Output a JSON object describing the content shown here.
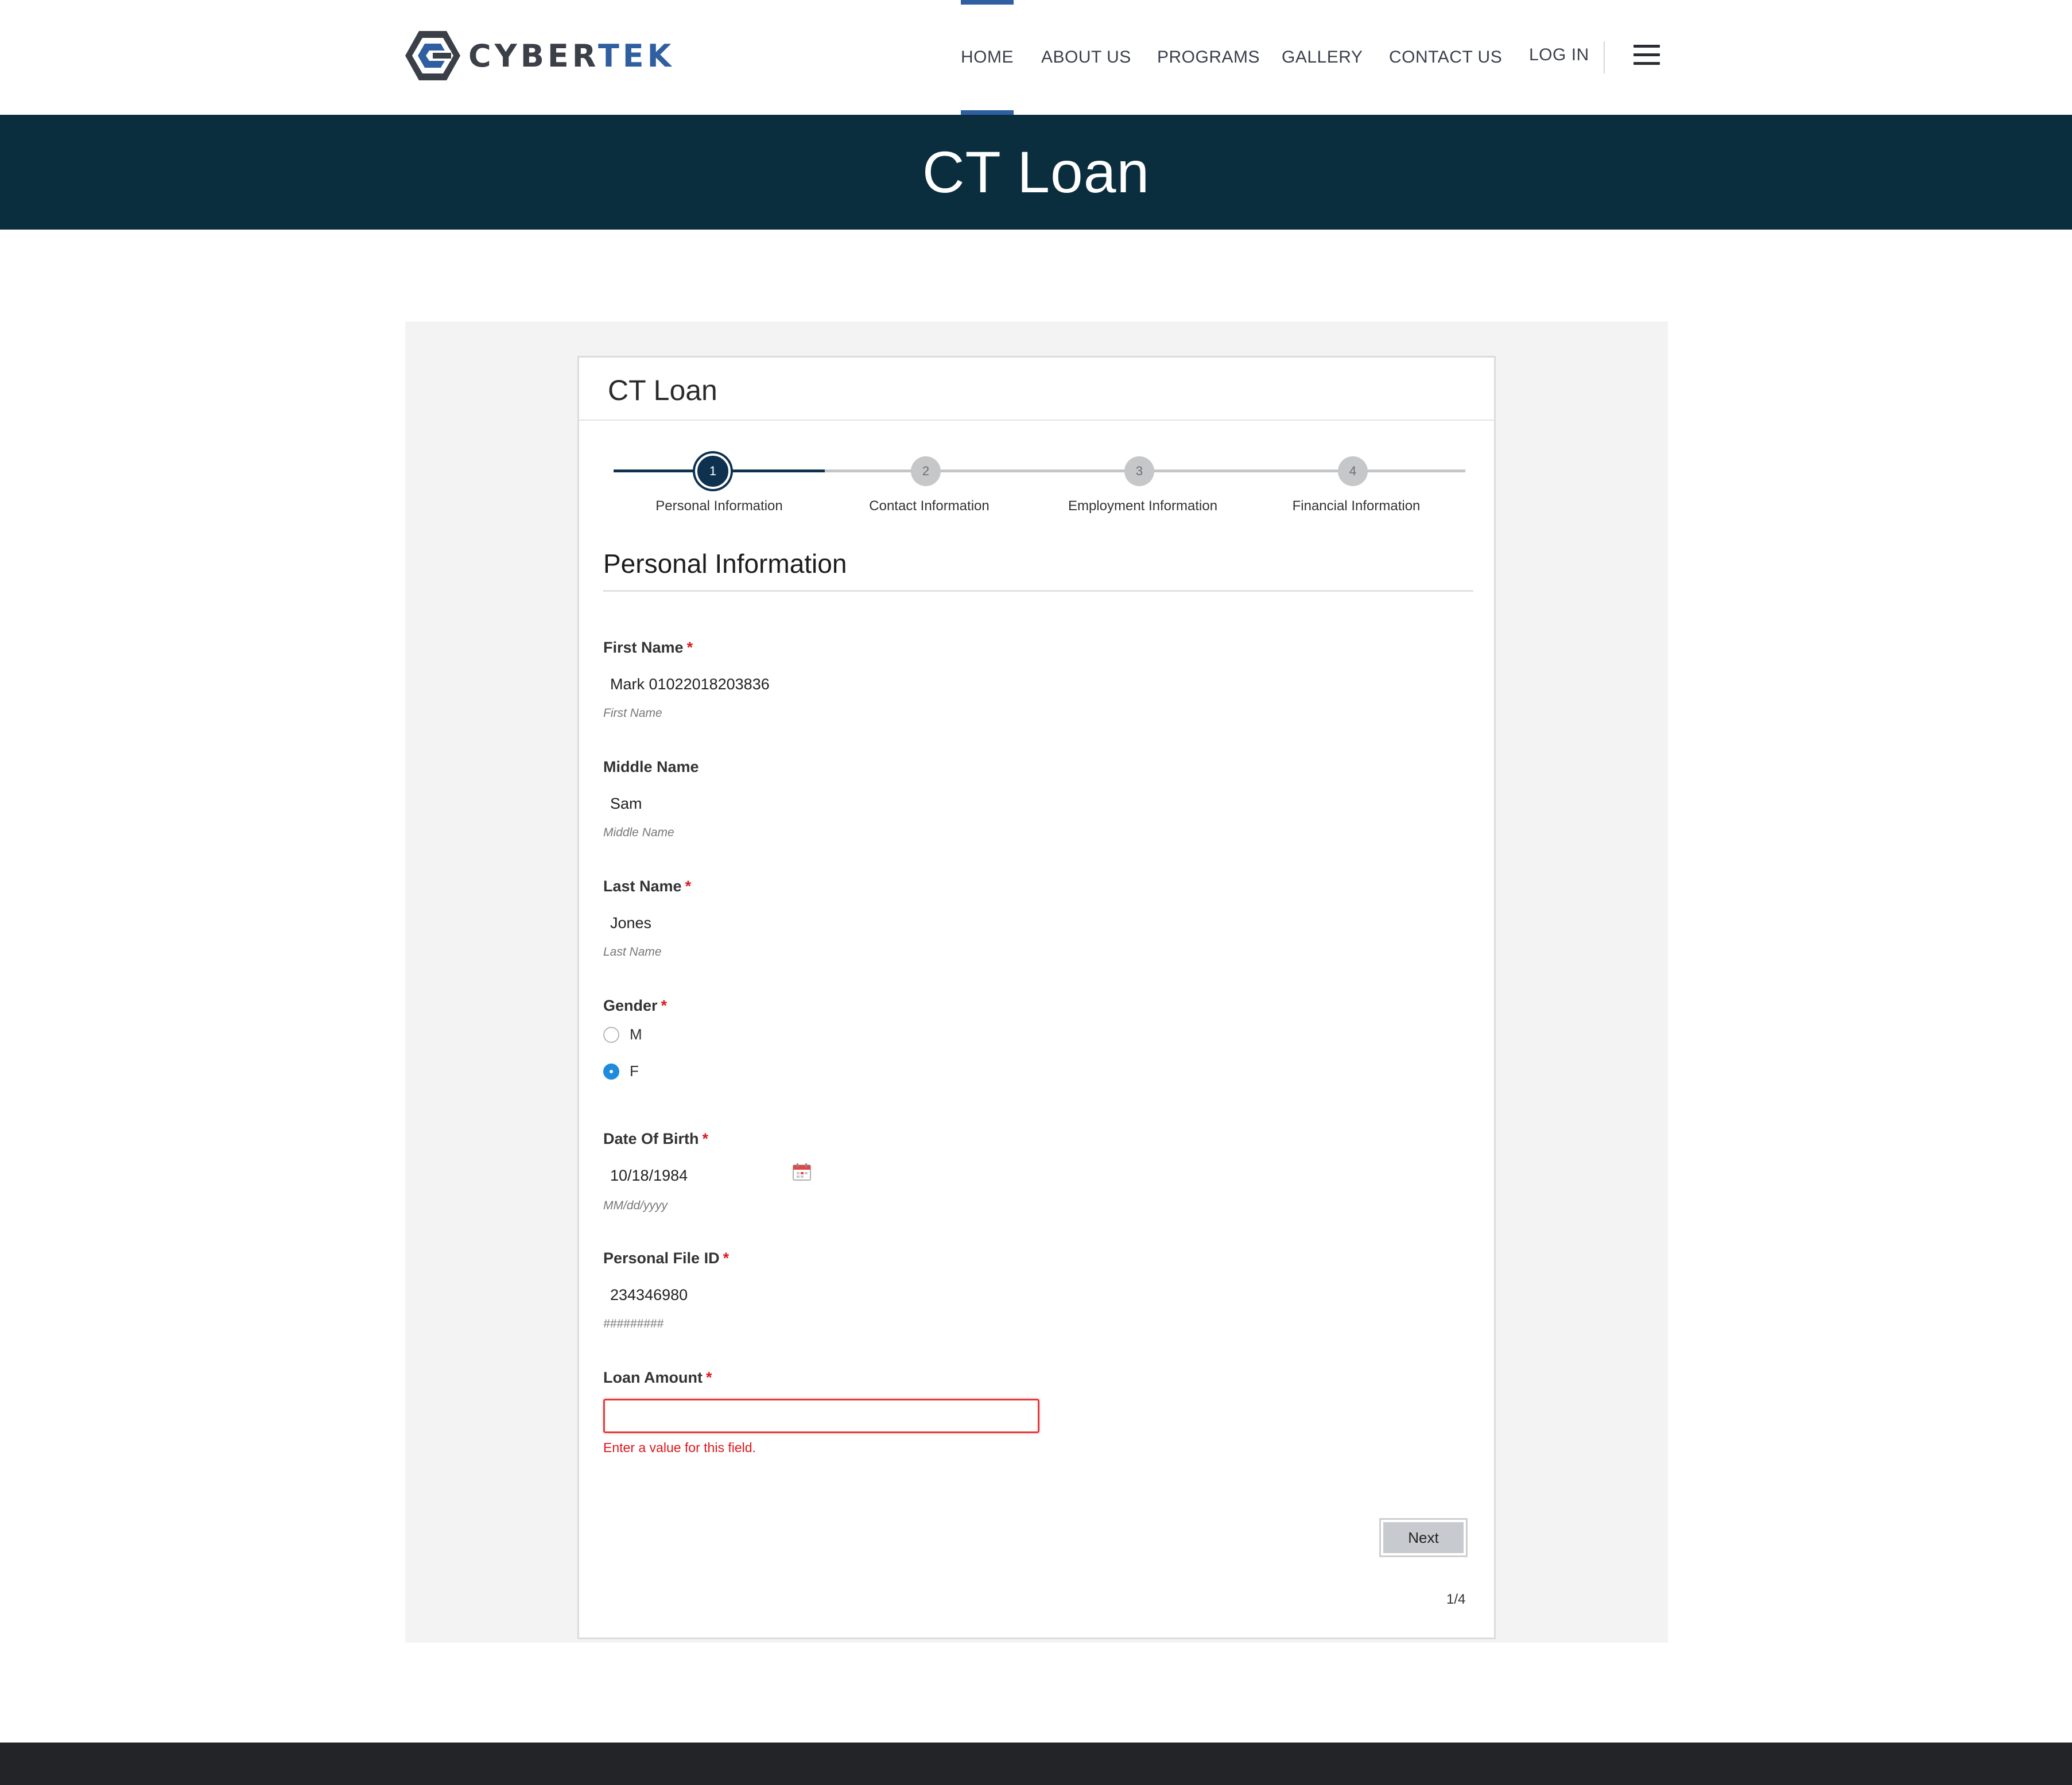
{
  "brand": {
    "logo_part1": "CYBER",
    "logo_part2": "TEK",
    "brand_blue": "#2f5fa0",
    "brand_gray": "#3b3f47"
  },
  "nav": {
    "items": [
      {
        "label": "HOME",
        "active": true
      },
      {
        "label": "ABOUT US",
        "active": false
      },
      {
        "label": "PROGRAMS",
        "active": false
      },
      {
        "label": "GALLERY",
        "active": false
      },
      {
        "label": "CONTACT US",
        "active": false
      }
    ],
    "login_label": "LOG IN",
    "menu_icon": "hamburger-icon"
  },
  "banner": {
    "title": "CT Loan",
    "background": "#0b2e3f"
  },
  "form": {
    "title": "CT Loan",
    "steps": [
      {
        "number": "1",
        "label": "Personal Information",
        "state": "current"
      },
      {
        "number": "2",
        "label": "Contact Information",
        "state": "todo"
      },
      {
        "number": "3",
        "label": "Employment Information",
        "state": "todo"
      },
      {
        "number": "4",
        "label": "Financial Information",
        "state": "todo"
      }
    ],
    "section_title": "Personal Information",
    "fields": {
      "first_name": {
        "label": "First Name",
        "required": "*",
        "value": "Mark 01022018203836",
        "hint": "First Name"
      },
      "middle_name": {
        "label": "Middle Name",
        "value": "Sam",
        "hint": "Middle Name"
      },
      "last_name": {
        "label": "Last Name",
        "required": "*",
        "value": "Jones",
        "hint": "Last Name"
      },
      "gender": {
        "label": "Gender",
        "required": "*",
        "options": [
          "M",
          "F"
        ],
        "selected": "F"
      },
      "dob": {
        "label": "Date Of Birth",
        "required": "*",
        "value": "10/18/1984",
        "hint": "MM/dd/yyyy",
        "icon": "calendar-icon"
      },
      "file_id": {
        "label": "Personal File ID",
        "required": "*",
        "value": "234346980",
        "hint": "#########"
      },
      "loan_amount": {
        "label": "Loan Amount",
        "required": "*",
        "value": "",
        "error": "Enter a value for this field."
      }
    },
    "next_label": "Next",
    "page_indicator": "1/4",
    "error_color": "#e0161b",
    "accent_color": "#0e3150"
  }
}
